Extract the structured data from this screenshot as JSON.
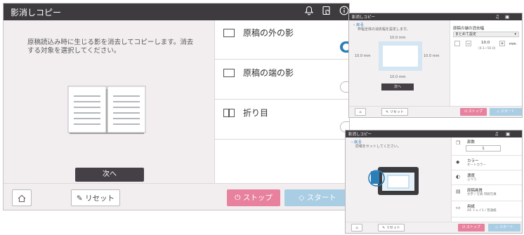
{
  "main": {
    "title": "影消しコピー",
    "description": "原稿読込み時に生じる影を消去してコピーします。消去する対象を選択してください。",
    "next_label": "次へ",
    "options": [
      {
        "label": "原稿の外の影",
        "on": true
      },
      {
        "label": "原稿の端の影",
        "on": false
      },
      {
        "label": "折り目",
        "on": false
      }
    ],
    "footer": {
      "reset": "リセット",
      "stop": "ストップ",
      "start": "スタート"
    }
  },
  "win1": {
    "title": "影消しコピー",
    "back": "戻る",
    "hint": "枠幅全体の消去幅を設定します。",
    "top_mm": "10.0 mm",
    "left_mm": "10.0 mm",
    "right_mm": "10.0 mm",
    "bottom_mm": "10.0 mm",
    "next_label": "次へ",
    "panel_title": "原稿の端の消去幅",
    "select_value": "まとめて設定",
    "stepper_value": "10.0",
    "stepper_unit": "mm",
    "stepper_range": "(0.1~50.0)",
    "footer": {
      "reset": "リセット",
      "stop": "ストップ",
      "start": "スタート"
    }
  },
  "win2": {
    "title": "影消しコピー",
    "back": "戻る",
    "hint": "原稿をセットしてください。",
    "items": [
      {
        "title": "部数",
        "sub": "1",
        "icon": "copies-icon"
      },
      {
        "title": "カラー",
        "sub": "オートカラー",
        "icon": "color-icon"
      },
      {
        "title": "濃度",
        "sub": "ふつう",
        "icon": "density-icon"
      },
      {
        "title": "原稿画質",
        "sub": "文字 / 写真 印刷写真",
        "icon": "quality-icon"
      },
      {
        "title": "用紙",
        "sub": "A4 トレイ1 / 普通紙",
        "icon": "paper-icon"
      }
    ],
    "footer": {
      "reset": "リセット",
      "stop": "ストップ",
      "start": "スタート"
    }
  },
  "colors": {
    "titlebar": "#3e3b3f",
    "accent_blue": "#2a7fb8",
    "stop_pink": "#e8819e",
    "start_blue": "#a9cde3"
  }
}
